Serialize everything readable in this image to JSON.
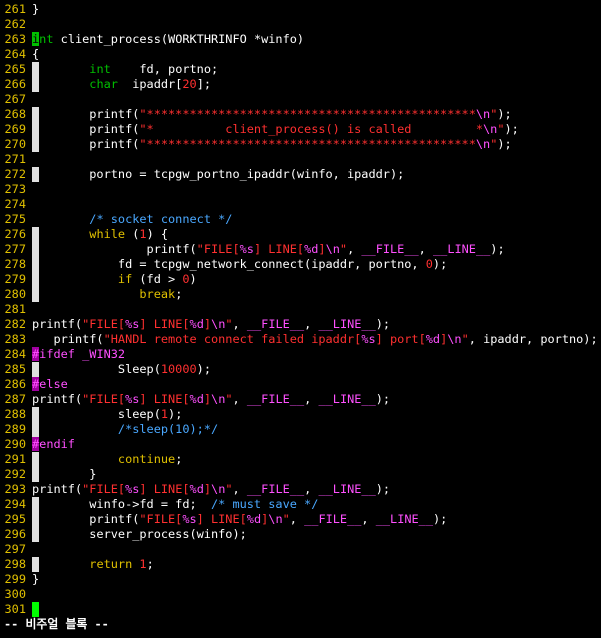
{
  "editor": {
    "status_text": "-- 비주얼 블록 --",
    "colors": {
      "line_number": "#e0c000",
      "string": "#ff3030",
      "keyword": "#00c000",
      "comment": "#4aa8ff",
      "preproc": "#ff50ff",
      "cursor": "#00ff00",
      "block_gutter": "#e0e0e0"
    },
    "lines": [
      {
        "n": "261",
        "t": "}"
      },
      {
        "n": "262",
        "t": ""
      },
      {
        "n": "263",
        "t": "int client_process(WORKTHRINFO *winfo)"
      },
      {
        "n": "264",
        "t": "{"
      },
      {
        "n": "265",
        "t": "        int    fd, portno;"
      },
      {
        "n": "266",
        "t": "        char  ipaddr[20];"
      },
      {
        "n": "267",
        "t": ""
      },
      {
        "n": "268",
        "t": "        printf(\"**********************************************\\n\");"
      },
      {
        "n": "269",
        "t": "        printf(\"*          client_process() is called         *\\n\");"
      },
      {
        "n": "270",
        "t": "        printf(\"**********************************************\\n\");"
      },
      {
        "n": "271",
        "t": ""
      },
      {
        "n": "272",
        "t": "        portno = tcpgw_portno_ipaddr(winfo, ipaddr);"
      },
      {
        "n": "273",
        "t": ""
      },
      {
        "n": "274",
        "t": ""
      },
      {
        "n": "275",
        "t": "        /* socket connect */"
      },
      {
        "n": "276",
        "t": "        while (1) {"
      },
      {
        "n": "277",
        "t": "                printf(\"FILE[%s] LINE[%d]\\n\", __FILE__, __LINE__);"
      },
      {
        "n": "278",
        "t": "            fd = tcpgw_network_connect(ipaddr, portno, 0);"
      },
      {
        "n": "279",
        "t": "            if (fd > 0)"
      },
      {
        "n": "280",
        "t": "               break;"
      },
      {
        "n": "281",
        "t": ""
      },
      {
        "n": "282",
        "t": "printf(\"FILE[%s] LINE[%d]\\n\", __FILE__, __LINE__);"
      },
      {
        "n": "283",
        "t": "   printf(\"HANDL remote connect failed ipaddr[%s] port[%d]\\n\", ipaddr, portno);"
      },
      {
        "n": "284",
        "t": "#ifdef _WIN32"
      },
      {
        "n": "285",
        "t": "            Sleep(10000);"
      },
      {
        "n": "286",
        "t": "#else"
      },
      {
        "n": "287",
        "t": "printf(\"FILE[%s] LINE[%d]\\n\", __FILE__, __LINE__);"
      },
      {
        "n": "288",
        "t": "            sleep(1);"
      },
      {
        "n": "289",
        "t": "            /*sleep(10);*/"
      },
      {
        "n": "290",
        "t": "#endif"
      },
      {
        "n": "291",
        "t": "            continue;"
      },
      {
        "n": "292",
        "t": "        }"
      },
      {
        "n": "293",
        "t": "printf(\"FILE[%s] LINE[%d]\\n\", __FILE__, __LINE__);"
      },
      {
        "n": "294",
        "t": "        winfo->fd = fd;  /* must save */"
      },
      {
        "n": "295",
        "t": "        printf(\"FILE[%s] LINE[%d]\\n\", __FILE__, __LINE__);"
      },
      {
        "n": "296",
        "t": "        server_process(winfo);"
      },
      {
        "n": "297",
        "t": ""
      },
      {
        "n": "298",
        "t": "        return 1;"
      },
      {
        "n": "299",
        "t": "}"
      },
      {
        "n": "300",
        "t": ""
      },
      {
        "n": "301",
        "t": ""
      }
    ]
  }
}
